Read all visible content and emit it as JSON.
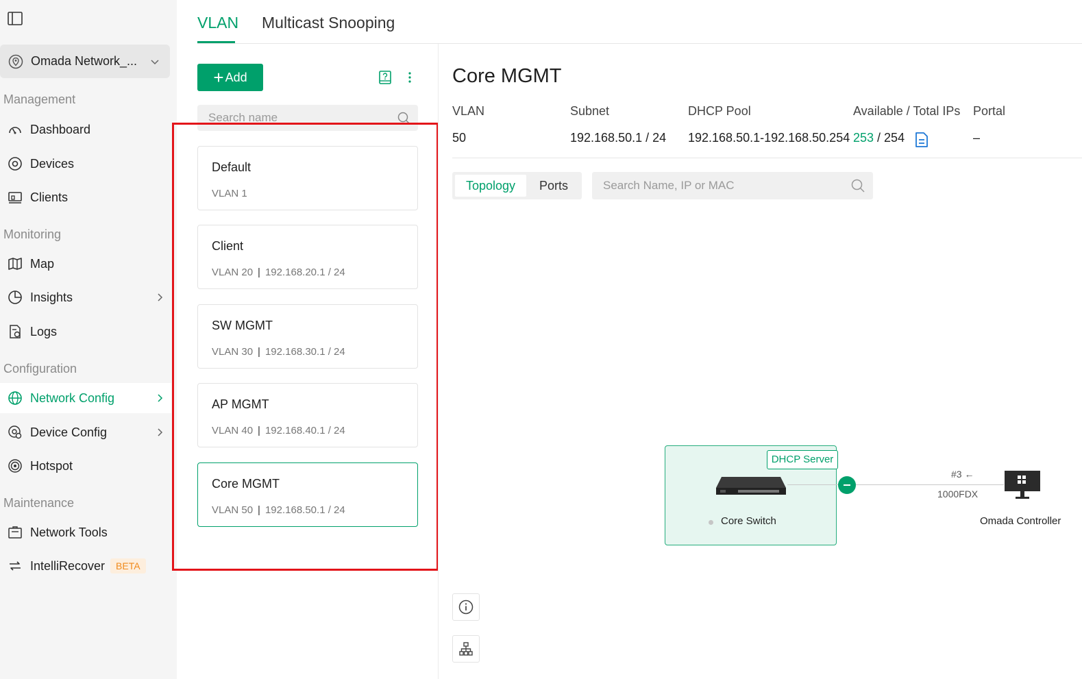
{
  "sidebar": {
    "site_name": "Omada Network_...",
    "sections": {
      "management": "Management",
      "monitoring": "Monitoring",
      "configuration": "Configuration",
      "maintenance": "Maintenance"
    },
    "items": [
      {
        "label": "Dashboard",
        "icon": "dashboard-icon"
      },
      {
        "label": "Devices",
        "icon": "devices-icon"
      },
      {
        "label": "Clients",
        "icon": "clients-icon"
      },
      {
        "label": "Map",
        "icon": "map-icon"
      },
      {
        "label": "Insights",
        "icon": "insights-icon"
      },
      {
        "label": "Logs",
        "icon": "logs-icon"
      },
      {
        "label": "Network Config",
        "icon": "globe-icon"
      },
      {
        "label": "Device Config",
        "icon": "device-config-icon"
      },
      {
        "label": "Hotspot",
        "icon": "hotspot-icon"
      },
      {
        "label": "Network Tools",
        "icon": "network-tools-icon"
      },
      {
        "label": "IntelliRecover",
        "icon": "recover-icon",
        "badge": "BETA"
      }
    ],
    "active_item": "Network Config"
  },
  "tabs": [
    {
      "label": "VLAN",
      "active": true
    },
    {
      "label": "Multicast Snooping",
      "active": false
    }
  ],
  "vlan_list": {
    "add_label": "Add",
    "search_placeholder": "Search name",
    "cards": [
      {
        "name": "Default",
        "vlan": "VLAN 1",
        "subnet": ""
      },
      {
        "name": "Client",
        "vlan": "VLAN 20",
        "subnet": "192.168.20.1 / 24"
      },
      {
        "name": "SW MGMT",
        "vlan": "VLAN 30",
        "subnet": "192.168.30.1 / 24"
      },
      {
        "name": "AP MGMT",
        "vlan": "VLAN 40",
        "subnet": "192.168.40.1 / 24"
      },
      {
        "name": "Core MGMT",
        "vlan": "VLAN 50",
        "subnet": "192.168.50.1 / 24"
      }
    ],
    "selected": "Core MGMT"
  },
  "detail": {
    "title": "Core MGMT",
    "headers": {
      "vlan": "VLAN",
      "subnet": "Subnet",
      "dhcp_pool": "DHCP Pool",
      "available_total": "Available / Total IPs",
      "portal": "Portal"
    },
    "values": {
      "vlan": "50",
      "subnet": "192.168.50.1 / 24",
      "dhcp_pool": "192.168.50.1-192.168.50.254",
      "available": "253",
      "total": " / 254",
      "portal": "–"
    },
    "view_tabs": {
      "topology": "Topology",
      "ports": "Ports"
    },
    "search_placeholder": "Search Name, IP or MAC"
  },
  "topology": {
    "dhcp_tag": "DHCP Server",
    "core_device": "Core Switch",
    "port": "#3 ←",
    "speed": "1000FDX",
    "controller": "Omada Controller"
  },
  "colors": {
    "accent": "#00a06b",
    "highlight_frame": "#e3151a",
    "beta": "#f08a1c"
  }
}
